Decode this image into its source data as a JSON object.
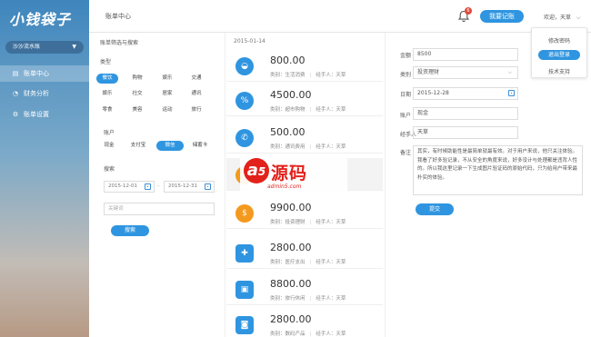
{
  "app": {
    "logo": "小钱袋子"
  },
  "sidebar": {
    "account_select": "沙沙流水账",
    "items": [
      {
        "label": "账单中心",
        "icon": "list-icon"
      },
      {
        "label": "财务分析",
        "icon": "pie-chart-icon"
      },
      {
        "label": "账单设置",
        "icon": "gear-icon"
      }
    ]
  },
  "header": {
    "title": "账单中心",
    "notification_count": "6",
    "record_button": "我要记账",
    "welcome": "欢迎，天草",
    "user_menu": [
      "修改密码",
      "退出登录",
      "技术支持"
    ]
  },
  "filter": {
    "title": "账单筛选与搜索",
    "type_label": "类型",
    "types": [
      "餐饮",
      "购物",
      "娱乐",
      "交通",
      "娱乐",
      "社交",
      "居家",
      "通讯",
      "零食",
      "美容",
      "运动",
      "旅行"
    ],
    "selected_type": "餐饮",
    "account_label": "账户",
    "accounts": [
      "现金",
      "支付宝",
      "微信",
      "储蓄卡"
    ],
    "selected_account": "微信",
    "search_label": "搜索",
    "date_from": "2015-12-01",
    "date_to": "2015-12-31",
    "date_sep": "-",
    "keyword_placeholder": "关键词",
    "search_button": "搜索"
  },
  "list": {
    "date": "2015-01-14",
    "category_prefix": "类别：",
    "handler_prefix": "经手人：",
    "entries": [
      {
        "amount": "800.00",
        "category": "生活消费",
        "handler": "天草",
        "icon": "bowl-icon",
        "color": "#2f95e0"
      },
      {
        "amount": "4500.00",
        "category": "超市购物",
        "handler": "天草",
        "icon": "discount-icon",
        "color": "#2f95e0"
      },
      {
        "amount": "500.00",
        "category": "通讯费用",
        "handler": "天草",
        "icon": "phone-icon",
        "color": "#2f95e0"
      },
      {
        "amount": "",
        "category": "",
        "handler": "",
        "icon": "coin-icon",
        "color": "#f39a1e"
      },
      {
        "amount": "9900.00",
        "category": "投资理财",
        "handler": "天草",
        "icon": "money-bag-icon",
        "color": "#f39a1e"
      },
      {
        "amount": "2800.00",
        "category": "医疗支出",
        "handler": "天草",
        "icon": "medical-kit-icon",
        "color": "#2f95e0"
      },
      {
        "amount": "8800.00",
        "category": "旅行休闲",
        "handler": "天草",
        "icon": "luggage-icon",
        "color": "#2f95e0"
      },
      {
        "amount": "2800.00",
        "category": "数码产品",
        "handler": "天草",
        "icon": "camera-icon",
        "color": "#2f95e0"
      }
    ]
  },
  "detail": {
    "amount_label": "金额",
    "amount_value": "8500",
    "category_label": "类别",
    "category_value": "投资理财",
    "date_label": "日期",
    "date_value": "2015-12-28",
    "account_label": "账户",
    "account_value": "现金",
    "handler_label": "经手人",
    "handler_value": "天草",
    "note_label": "备注",
    "note_value": "其实，有时候助能性是最简单就最有效。对于用户来说，他只关注体验。我看了好多验记录，不从安全的角度来说，好多没计与处理都是违背人性的。所以我这里记录一下生成图片验证码的原始代码，只为给用户带来最朴实的体验。",
    "submit_button": "提交"
  },
  "watermark": {
    "logo_letter": "a",
    "logo_num": "5",
    "text": "源码",
    "site": "admin5.com"
  },
  "colors": {
    "primary": "#2f95e0",
    "accent_orange": "#f39a1e",
    "badge_red": "#e04a3a",
    "watermark_red": "#e3211b"
  }
}
